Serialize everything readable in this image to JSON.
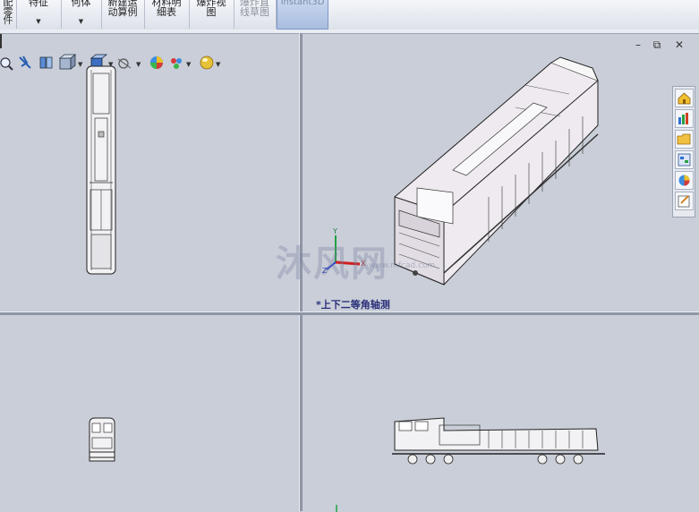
{
  "ribbon": {
    "buttons": [
      {
        "line1": "配",
        "line2": "零",
        "line3": "件",
        "arrow": false
      },
      {
        "line1": "",
        "line2": "特征",
        "arrow": true
      },
      {
        "line1": "",
        "line2": "何体",
        "arrow": true
      },
      {
        "line1": "新建运",
        "line2": "动算例",
        "arrow": false
      },
      {
        "line1": "材料明",
        "line2": "细表",
        "arrow": false
      },
      {
        "line1": "爆炸视",
        "line2": "图",
        "arrow": false
      },
      {
        "line1": "爆炸直",
        "line2": "线草图",
        "arrow": false,
        "dim": true
      },
      {
        "line1": "Instant3D",
        "line2": "",
        "arrow": false,
        "active": true
      }
    ]
  },
  "view_label": "*上下二等角轴测",
  "triad": {
    "x": "X",
    "y": "Y",
    "z": "Z"
  },
  "watermark": {
    "text": "沐风网",
    "sub": "www.mfcad.com"
  },
  "window_controls": {
    "minimize": "–",
    "restore": "⧉",
    "close": "✕"
  },
  "taskpane": [
    "home-icon",
    "resources-icon",
    "folder-icon",
    "library-icon",
    "appearance-icon",
    "properties-icon"
  ],
  "colors": {
    "viewport": "#c7ccd6",
    "label": "#2a2f7a",
    "accent": "#7f97c4"
  }
}
